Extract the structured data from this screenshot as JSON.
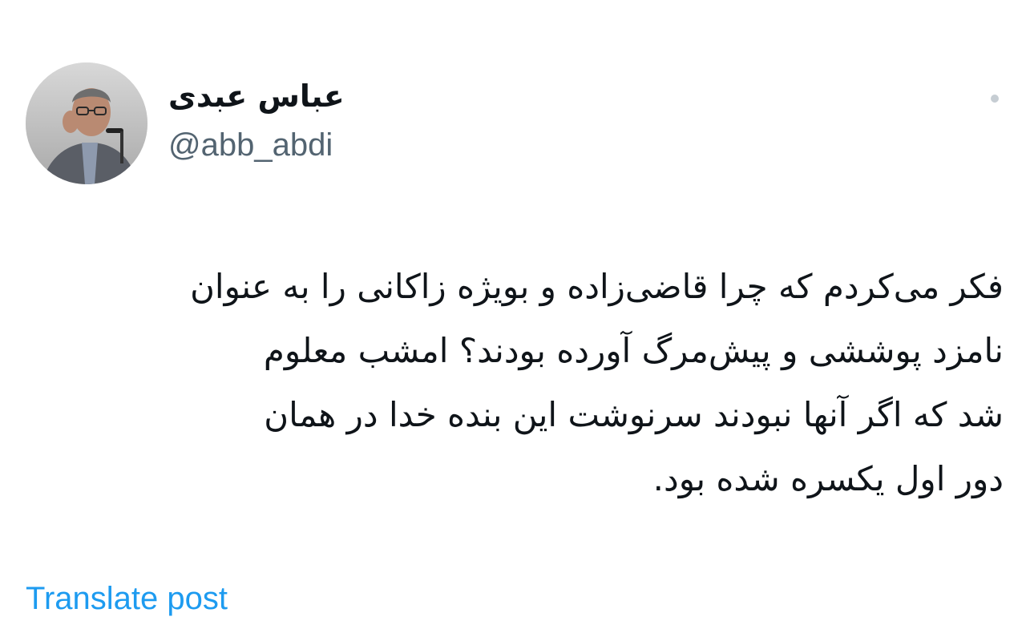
{
  "author": {
    "display_name": "عباس عبدی",
    "handle": "@abb_abdi"
  },
  "more_icon": "more-dot-icon",
  "tweet": {
    "lines": [
      "فکر می‌کردم که چرا قاضی‌زاده و بویژه زاکانی را به عنوان",
      "نامزد پوششی و پیش‌مرگ آورده بودند؟ امشب معلوم",
      "شد که اگر آنها نبودند سرنوشت این بنده خدا در همان",
      "دور اول یکسره شده بود."
    ]
  },
  "actions": {
    "translate_label": "Translate post"
  },
  "colors": {
    "text": "#0f1419",
    "secondary": "#536471",
    "link": "#1d9bf0"
  }
}
